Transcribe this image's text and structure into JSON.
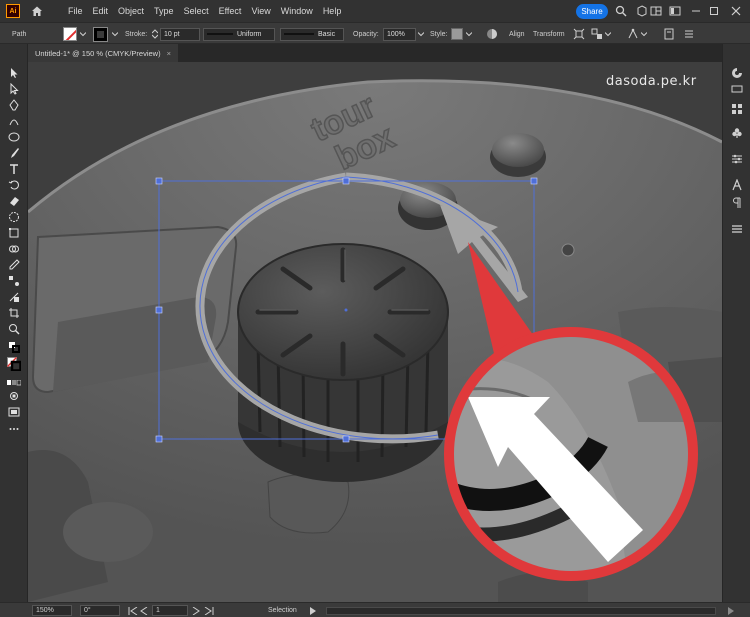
{
  "app": {
    "logo": "Ai"
  },
  "menu": {
    "items": [
      "File",
      "Edit",
      "Object",
      "Type",
      "Select",
      "Effect",
      "View",
      "Window",
      "Help"
    ],
    "share_label": "Share"
  },
  "control_bar": {
    "selection_type": "Path",
    "stroke_label": "Stroke:",
    "stroke_weight": "10 pt",
    "profile_uniform": "Uniform",
    "brush_basic": "Basic",
    "opacity_label": "Opacity:",
    "opacity_value": "100%",
    "style_label": "Style:",
    "align_label": "Align",
    "transform_label": "Transform"
  },
  "document": {
    "tab_title": "Untitled-1* @ 150 % (CMYK/Preview)",
    "close_glyph": "×"
  },
  "canvas": {
    "watermark": "dasoda.pe.kr",
    "device_logo_line1": "tour",
    "device_logo_line2": "box"
  },
  "status_bar": {
    "zoom": "150%",
    "rotation": "0°",
    "artboard": "1",
    "tool_name": "Selection"
  },
  "colors": {
    "accent": "#1473e6",
    "callout_ring": "#e0393b",
    "arrow_gray": "#a6a6a6",
    "selection_blue": "#4f6fd8"
  }
}
